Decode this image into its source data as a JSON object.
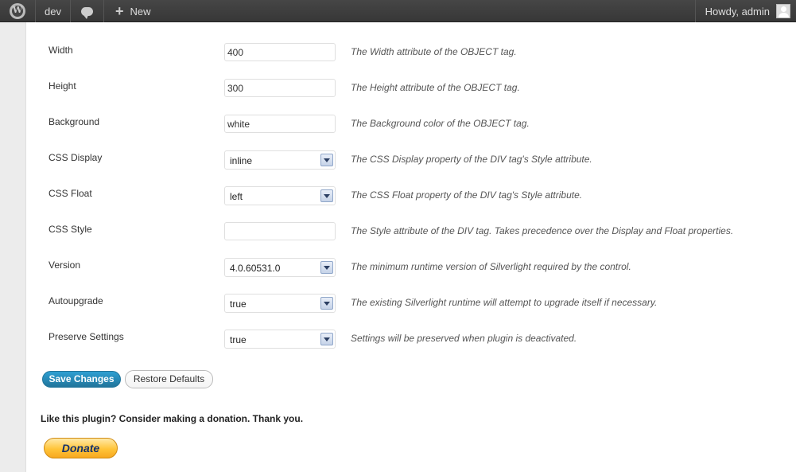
{
  "adminbar": {
    "site_name": "dev",
    "new_label": "New",
    "howdy": "Howdy, admin",
    "icons": {
      "wp": "wordpress-logo-icon",
      "comments": "comment-bubble-icon",
      "plus": "plus-icon",
      "avatar": "user-avatar-icon"
    }
  },
  "settings": {
    "rows": [
      {
        "label": "Width",
        "type": "text",
        "value": "400",
        "desc": "The Width attribute of the OBJECT tag."
      },
      {
        "label": "Height",
        "type": "text",
        "value": "300",
        "desc": "The Height attribute of the OBJECT tag."
      },
      {
        "label": "Background",
        "type": "text",
        "value": "white",
        "desc": "The Background color of the OBJECT tag."
      },
      {
        "label": "CSS Display",
        "type": "select",
        "value": "inline",
        "desc": "The CSS Display property of the DIV tag's Style attribute."
      },
      {
        "label": "CSS Float",
        "type": "select",
        "value": "left",
        "desc": "The CSS Float property of the DIV tag's Style attribute."
      },
      {
        "label": "CSS Style",
        "type": "text",
        "value": "",
        "desc": "The Style attribute of the DIV tag. Takes precedence over the Display and Float properties."
      },
      {
        "label": "Version",
        "type": "select",
        "value": "4.0.60531.0",
        "desc": "The minimum runtime version of Silverlight required by the control."
      },
      {
        "label": "Autoupgrade",
        "type": "select",
        "value": "true",
        "desc": "The existing Silverlight runtime will attempt to upgrade itself if necessary."
      },
      {
        "label": "Preserve Settings",
        "type": "select",
        "value": "true",
        "desc": "Settings will be preserved when plugin is deactivated."
      }
    ]
  },
  "buttons": {
    "save": "Save Changes",
    "restore": "Restore Defaults"
  },
  "donation": {
    "text": "Like this plugin? Consider making a donation. Thank you.",
    "button": "Donate"
  },
  "colors": {
    "primary": "#21759b",
    "adminbar": "#464646",
    "donate": "#ffc439"
  }
}
